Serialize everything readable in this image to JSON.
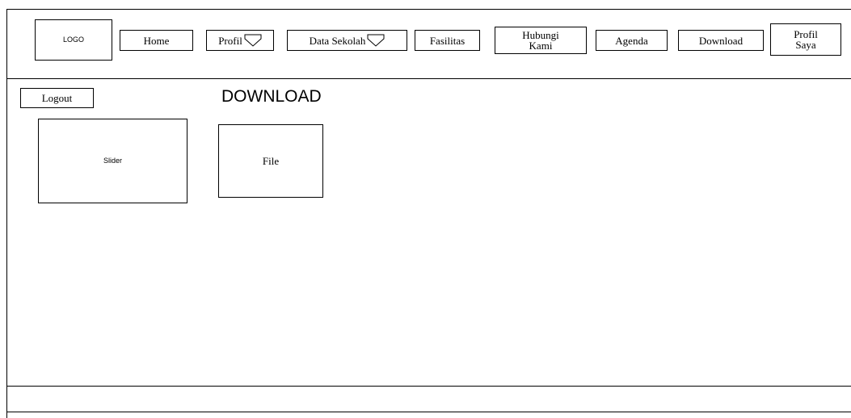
{
  "header": {
    "logo_label": "LOGO",
    "nav": {
      "home": "Home",
      "profil": "Profil",
      "data_sekolah": "Data Sekolah",
      "fasilitas": "Fasilitas",
      "hubungi_kami": [
        "Hubungi",
        "Kami"
      ],
      "agenda": "Agenda",
      "download": "Download",
      "profil_saya": [
        "Profil",
        "Saya"
      ]
    },
    "dropdown_icon": "chevron-down-icon"
  },
  "sidebar": {
    "logout_label": "Logout",
    "slider_label": "Slider"
  },
  "main": {
    "page_title": "DOWNLOAD",
    "file_label": "File"
  },
  "footer": {
    "text": ""
  }
}
